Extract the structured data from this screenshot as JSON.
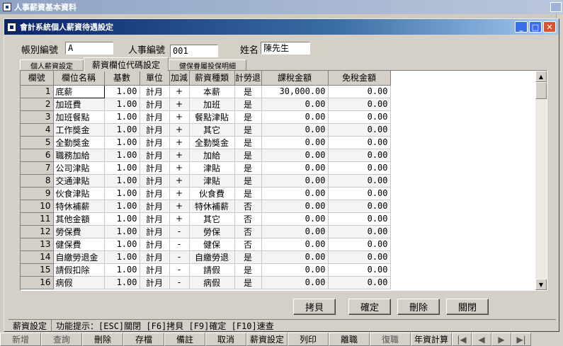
{
  "outer_window": {
    "title": "人事薪資基本資料"
  },
  "dialog": {
    "title": "會計系統個人薪資待遇設定"
  },
  "header": {
    "account_label": "帳別編號",
    "account_value": "A",
    "emp_label": "人事編號",
    "emp_value": "001",
    "name_label": "姓名",
    "name_value": "陳先生"
  },
  "tabs": [
    "個人薪資設定",
    "薪資欄位代碼設定",
    "健保眷屬投保明細"
  ],
  "table": {
    "headers": [
      "欄號",
      "欄位名稱",
      "基數",
      "單位",
      "加減",
      "薪資種類",
      "計勞退",
      "課稅金額",
      "免稅金額"
    ],
    "rows": [
      [
        "1",
        "底薪",
        "1.00",
        "計月",
        "+",
        "本薪",
        "是",
        "30,000.00",
        "0.00"
      ],
      [
        "2",
        "加班費",
        "1.00",
        "計月",
        "+",
        "加班",
        "是",
        "0.00",
        "0.00"
      ],
      [
        "3",
        "加班餐點",
        "1.00",
        "計月",
        "+",
        "餐點津貼",
        "是",
        "0.00",
        "0.00"
      ],
      [
        "4",
        "工作獎金",
        "1.00",
        "計月",
        "+",
        "其它",
        "是",
        "0.00",
        "0.00"
      ],
      [
        "5",
        "全勤獎金",
        "1.00",
        "計月",
        "+",
        "全勤獎金",
        "是",
        "0.00",
        "0.00"
      ],
      [
        "6",
        "職務加給",
        "1.00",
        "計月",
        "+",
        "加給",
        "是",
        "0.00",
        "0.00"
      ],
      [
        "7",
        "公司津貼",
        "1.00",
        "計月",
        "+",
        "津貼",
        "是",
        "0.00",
        "0.00"
      ],
      [
        "8",
        "交通津貼",
        "1.00",
        "計月",
        "+",
        "津貼",
        "是",
        "0.00",
        "0.00"
      ],
      [
        "9",
        "伙食津貼",
        "1.00",
        "計月",
        "+",
        "伙食費",
        "是",
        "0.00",
        "0.00"
      ],
      [
        "10",
        "特休補薪",
        "1.00",
        "計月",
        "+",
        "特休補薪",
        "否",
        "0.00",
        "0.00"
      ],
      [
        "11",
        "其他金額",
        "1.00",
        "計月",
        "+",
        "其它",
        "否",
        "0.00",
        "0.00"
      ],
      [
        "12",
        "勞保費",
        "1.00",
        "計月",
        "-",
        "勞保",
        "否",
        "0.00",
        "0.00"
      ],
      [
        "13",
        "健保費",
        "1.00",
        "計月",
        "-",
        "健保",
        "否",
        "0.00",
        "0.00"
      ],
      [
        "14",
        "自繳勞退金",
        "1.00",
        "計月",
        "-",
        "自繳勞退",
        "是",
        "0.00",
        "0.00"
      ],
      [
        "15",
        "請假扣除",
        "1.00",
        "計月",
        "-",
        "請假",
        "是",
        "0.00",
        "0.00"
      ],
      [
        "16",
        "病假",
        "1.00",
        "計月",
        "-",
        "病假",
        "是",
        "0.00",
        "0.00"
      ]
    ]
  },
  "buttons": {
    "copy": "拷貝",
    "confirm": "確定",
    "delete": "刪除",
    "close": "關閉"
  },
  "status": {
    "mode": "薪資設定",
    "hint": "功能提示：[ESC]關閉 [F6]拷貝 [F9]確定 [F10]速查"
  },
  "toolbar": [
    "新增",
    "查詢",
    "刪除",
    "存檔",
    "備註",
    "取消",
    "薪資設定",
    "列印",
    "離職",
    "復職",
    "年資計算"
  ],
  "colors": {
    "title_start": "#0a246a",
    "title_end": "#a6caf0",
    "face": "#d4d0c8"
  }
}
